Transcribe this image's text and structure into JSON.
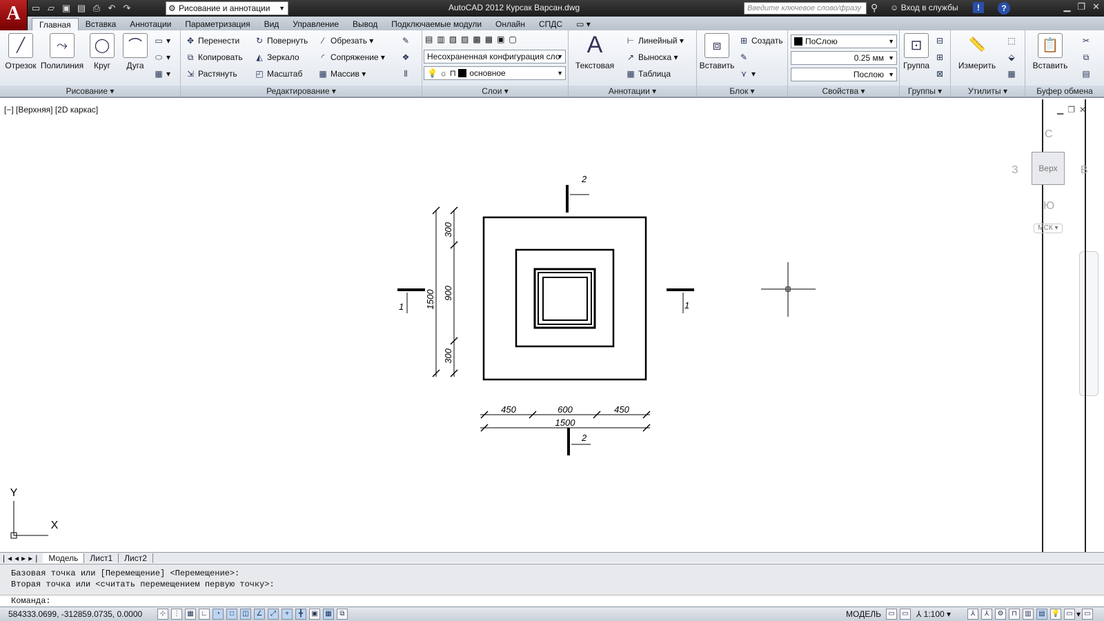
{
  "titlebar": {
    "app_button": "A",
    "workspace": "Рисование и аннотации",
    "title": "AutoCAD 2012   Курсак Варсан.dwg",
    "search_placeholder": "Введите ключевое слово/фразу",
    "signin": "Вход в службы",
    "help": "?"
  },
  "tabs": [
    "Главная",
    "Вставка",
    "Аннотации",
    "Параметризация",
    "Вид",
    "Управление",
    "Вывод",
    "Подключаемые модули",
    "Онлайн",
    "СПДС"
  ],
  "ribbon": {
    "draw": {
      "label": "Рисование",
      "line": "Отрезок",
      "polyline": "Полилиния",
      "circle": "Круг",
      "arc": "Дуга"
    },
    "modify": {
      "label": "Редактирование",
      "move": "Перенести",
      "copy": "Копировать",
      "stretch": "Растянуть",
      "rotate": "Повернуть",
      "mirror": "Зеркало",
      "scale": "Масштаб",
      "trim": "Обрезать",
      "fillet": "Сопряжение",
      "array": "Массив"
    },
    "layers": {
      "label": "Слои",
      "state": "Несохраненная конфигурация сло",
      "current": "основное"
    },
    "annotation": {
      "label": "Аннотации",
      "text": "Текстовая",
      "linear": "Линейный",
      "leader": "Выноска",
      "table": "Таблица"
    },
    "block": {
      "label": "Блок",
      "insert": "Вставить",
      "create": "Создать"
    },
    "properties": {
      "label": "Свойства",
      "color": "ПоСлою",
      "lineweight": "0.25 мм",
      "linetype": "Послою"
    },
    "groups": {
      "label": "Группы",
      "group": "Группа"
    },
    "utilities": {
      "label": "Утилиты",
      "measure": "Измерить"
    },
    "clipboard": {
      "label": "Буфер обмена",
      "paste": "Вставить"
    }
  },
  "viewport": {
    "label": "[−] [Верхняя] [2D каркас]",
    "viewcube": {
      "face": "Верх",
      "north": "С",
      "west": "З",
      "east": "В",
      "south": "Ю"
    },
    "ucs_menu": "МСК",
    "axis_x": "X",
    "axis_y": "Y"
  },
  "drawing": {
    "section_1": "1",
    "section_2": "2",
    "dim_v_total": "1500",
    "dim_v_top": "300",
    "dim_v_mid": "900",
    "dim_v_bottom": "300",
    "dim_h_left": "450",
    "dim_h_mid": "600",
    "dim_h_right": "450",
    "dim_h_total": "1500"
  },
  "layout_tabs": [
    "Модель",
    "Лист1",
    "Лист2"
  ],
  "command": {
    "line1": "Базовая точка или [Перемещение] <Перемещение>:",
    "line2": "Вторая точка или <считать перемещением первую точку>:",
    "prompt": "Команда:"
  },
  "status": {
    "coords": "584333.0699, -312859.0735, 0.0000",
    "space": "МОДЕЛЬ",
    "scale": "1:100"
  }
}
